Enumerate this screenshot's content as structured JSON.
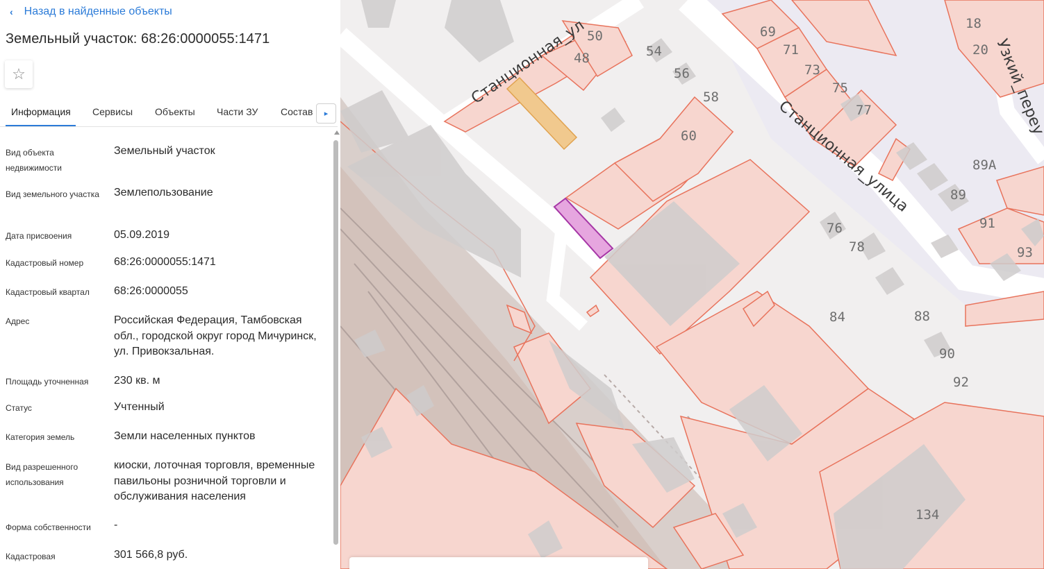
{
  "panel": {
    "back_label": "Назад в найденные объекты",
    "title": "Земельный участок: 68:26:0000055:1471",
    "favorite_icon": "☆",
    "tabs": [
      "Информация",
      "Сервисы",
      "Объекты",
      "Части ЗУ",
      "Состав"
    ],
    "tabs_more_icon": "▸",
    "rows": [
      {
        "label": "Вид объекта недвижимости",
        "value": "Земельный участок"
      },
      {
        "label": "Вид земельного участка",
        "value": "Землепользование"
      },
      {
        "label": "Дата присвоения",
        "value": "05.09.2019"
      },
      {
        "label": "Кадастровый номер",
        "value": "68:26:0000055:1471"
      },
      {
        "label": "Кадастровый квартал",
        "value": "68:26:0000055"
      },
      {
        "label": "Адрес",
        "value": "Российская Федерация, Тамбовская обл., городской округ город Мичуринск, ул. Привокзальная."
      },
      {
        "label": "Площадь уточненная",
        "value": "230 кв. м"
      },
      {
        "label": "Статус",
        "value": "Учтенный"
      },
      {
        "label": "Категория земель",
        "value": "Земли населенных пунктов"
      },
      {
        "label": "Вид разрешенного использования",
        "value": "киоски, лоточная торговля, временные павильоны розничной торговли и обслуживания населения"
      },
      {
        "label": "Форма собственности",
        "value": "-"
      },
      {
        "label": "Кадастровая",
        "value": "301 566,8 руб."
      }
    ]
  },
  "map": {
    "street_labels": [
      "Станционная_ул",
      "Станционная_улица",
      "Узкий_переу"
    ],
    "house_numbers": [
      "50",
      "48",
      "54",
      "56",
      "58",
      "60",
      "69",
      "71",
      "73",
      "75",
      "77",
      "18",
      "20",
      "89А",
      "89",
      "91",
      "93",
      "76",
      "78",
      "84",
      "88",
      "90",
      "92",
      "134"
    ],
    "colors": {
      "parcel_fill": "#f7d6cf",
      "parcel_stroke": "#e8735c",
      "building": "#d8d6d6",
      "selected_fill": "#e6a6df",
      "selected_stroke": "#a636a6",
      "highlight_building": "#f1c98e"
    }
  }
}
